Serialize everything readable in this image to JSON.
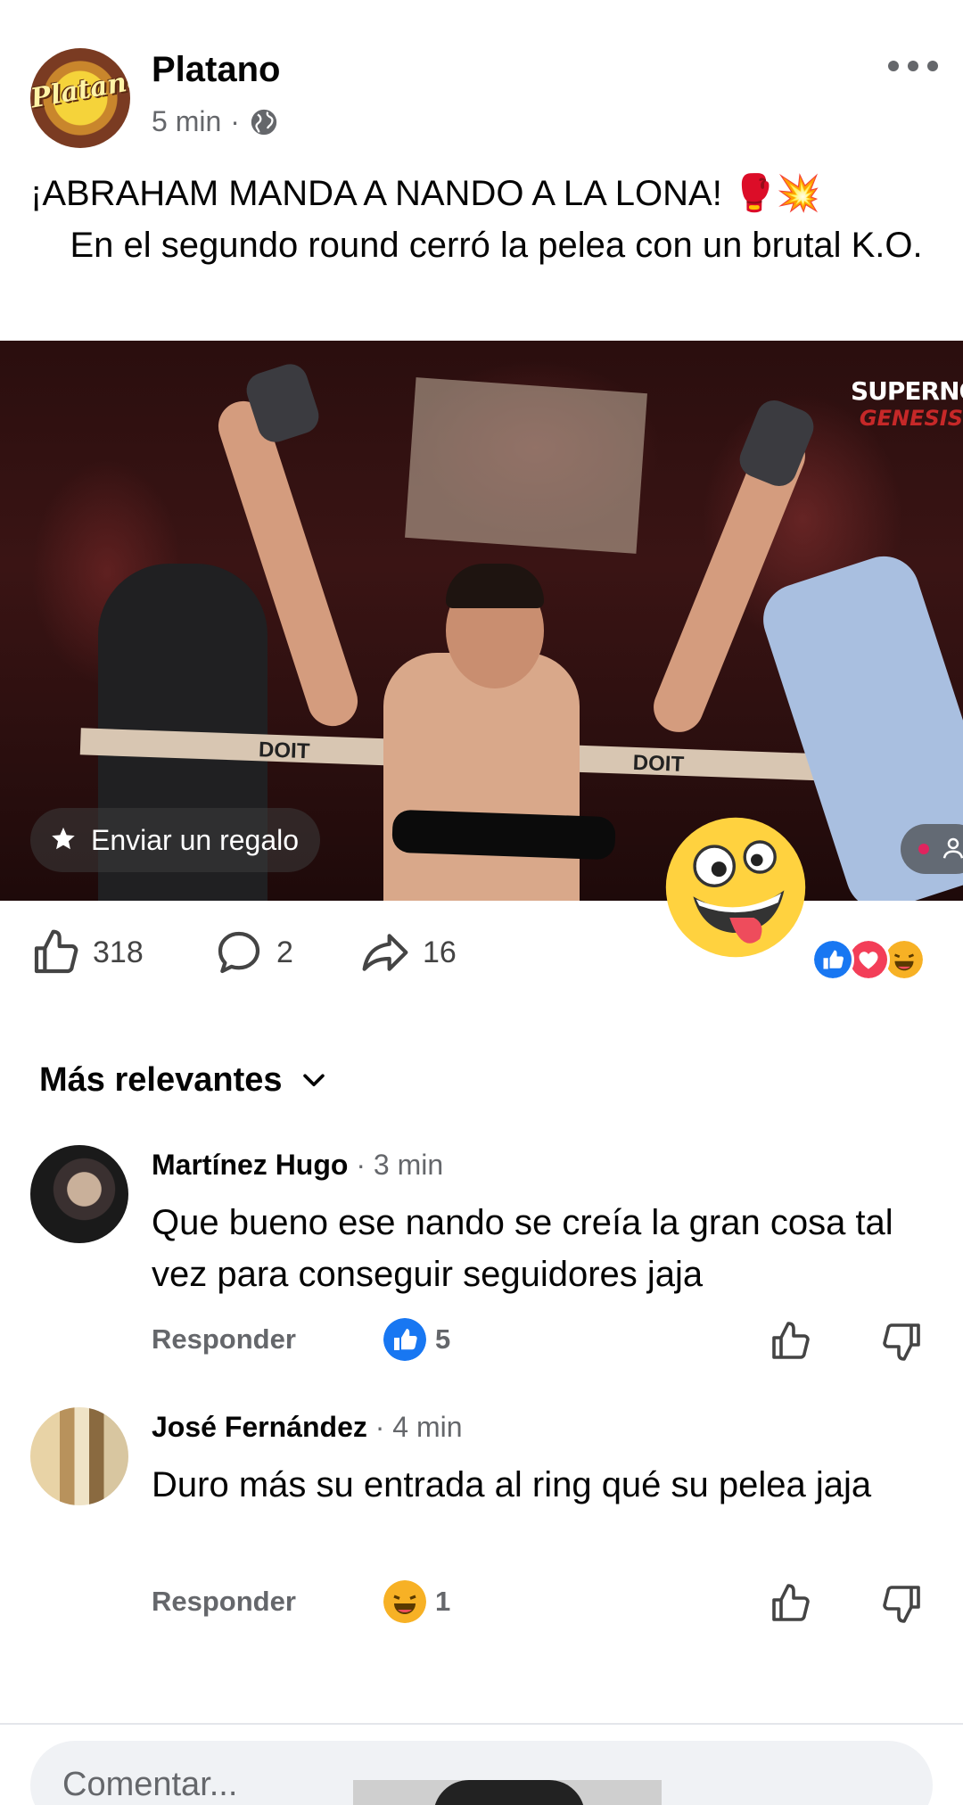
{
  "post": {
    "page_name": "Platano",
    "logo_text": "Platano",
    "time": "5 min",
    "separator": "·",
    "audience_icon": "globe-icon",
    "text_line1": "¡ABRAHAM MANDA A NANDO A LA LONA!",
    "text_emojis": "🥊💥",
    "text_line2": "    En el segundo round cerró la pelea con un brutal K.O."
  },
  "video": {
    "watermark_line1": "SUPERNOVA",
    "watermark_line2": "GENESIS",
    "ring_brand": "DOIT",
    "gift_label": "Enviar un regalo"
  },
  "engagement": {
    "likes": "318",
    "comments": "2",
    "shares": "16",
    "reaction_types": [
      "like",
      "love",
      "haha"
    ],
    "colors": {
      "like": "#1877f2",
      "love": "#f33e58",
      "haha": "#f7b125"
    }
  },
  "sort": {
    "label": "Más relevantes"
  },
  "comments": [
    {
      "author": "Martínez Hugo",
      "time": "· 3 min",
      "text": "Que bueno ese nando se creía la gran cosa tal vez para conseguir seguidores jaja",
      "reply_label": "Responder",
      "reaction_type": "like",
      "reaction_count": "5"
    },
    {
      "author": "José Fernández",
      "time": "· 4 min",
      "text": "Duro más su entrada al ring qué su pelea jaja",
      "reply_label": "Responder",
      "reaction_type": "haha",
      "reaction_count": "1"
    }
  ],
  "composer": {
    "placeholder": "Comentar..."
  }
}
